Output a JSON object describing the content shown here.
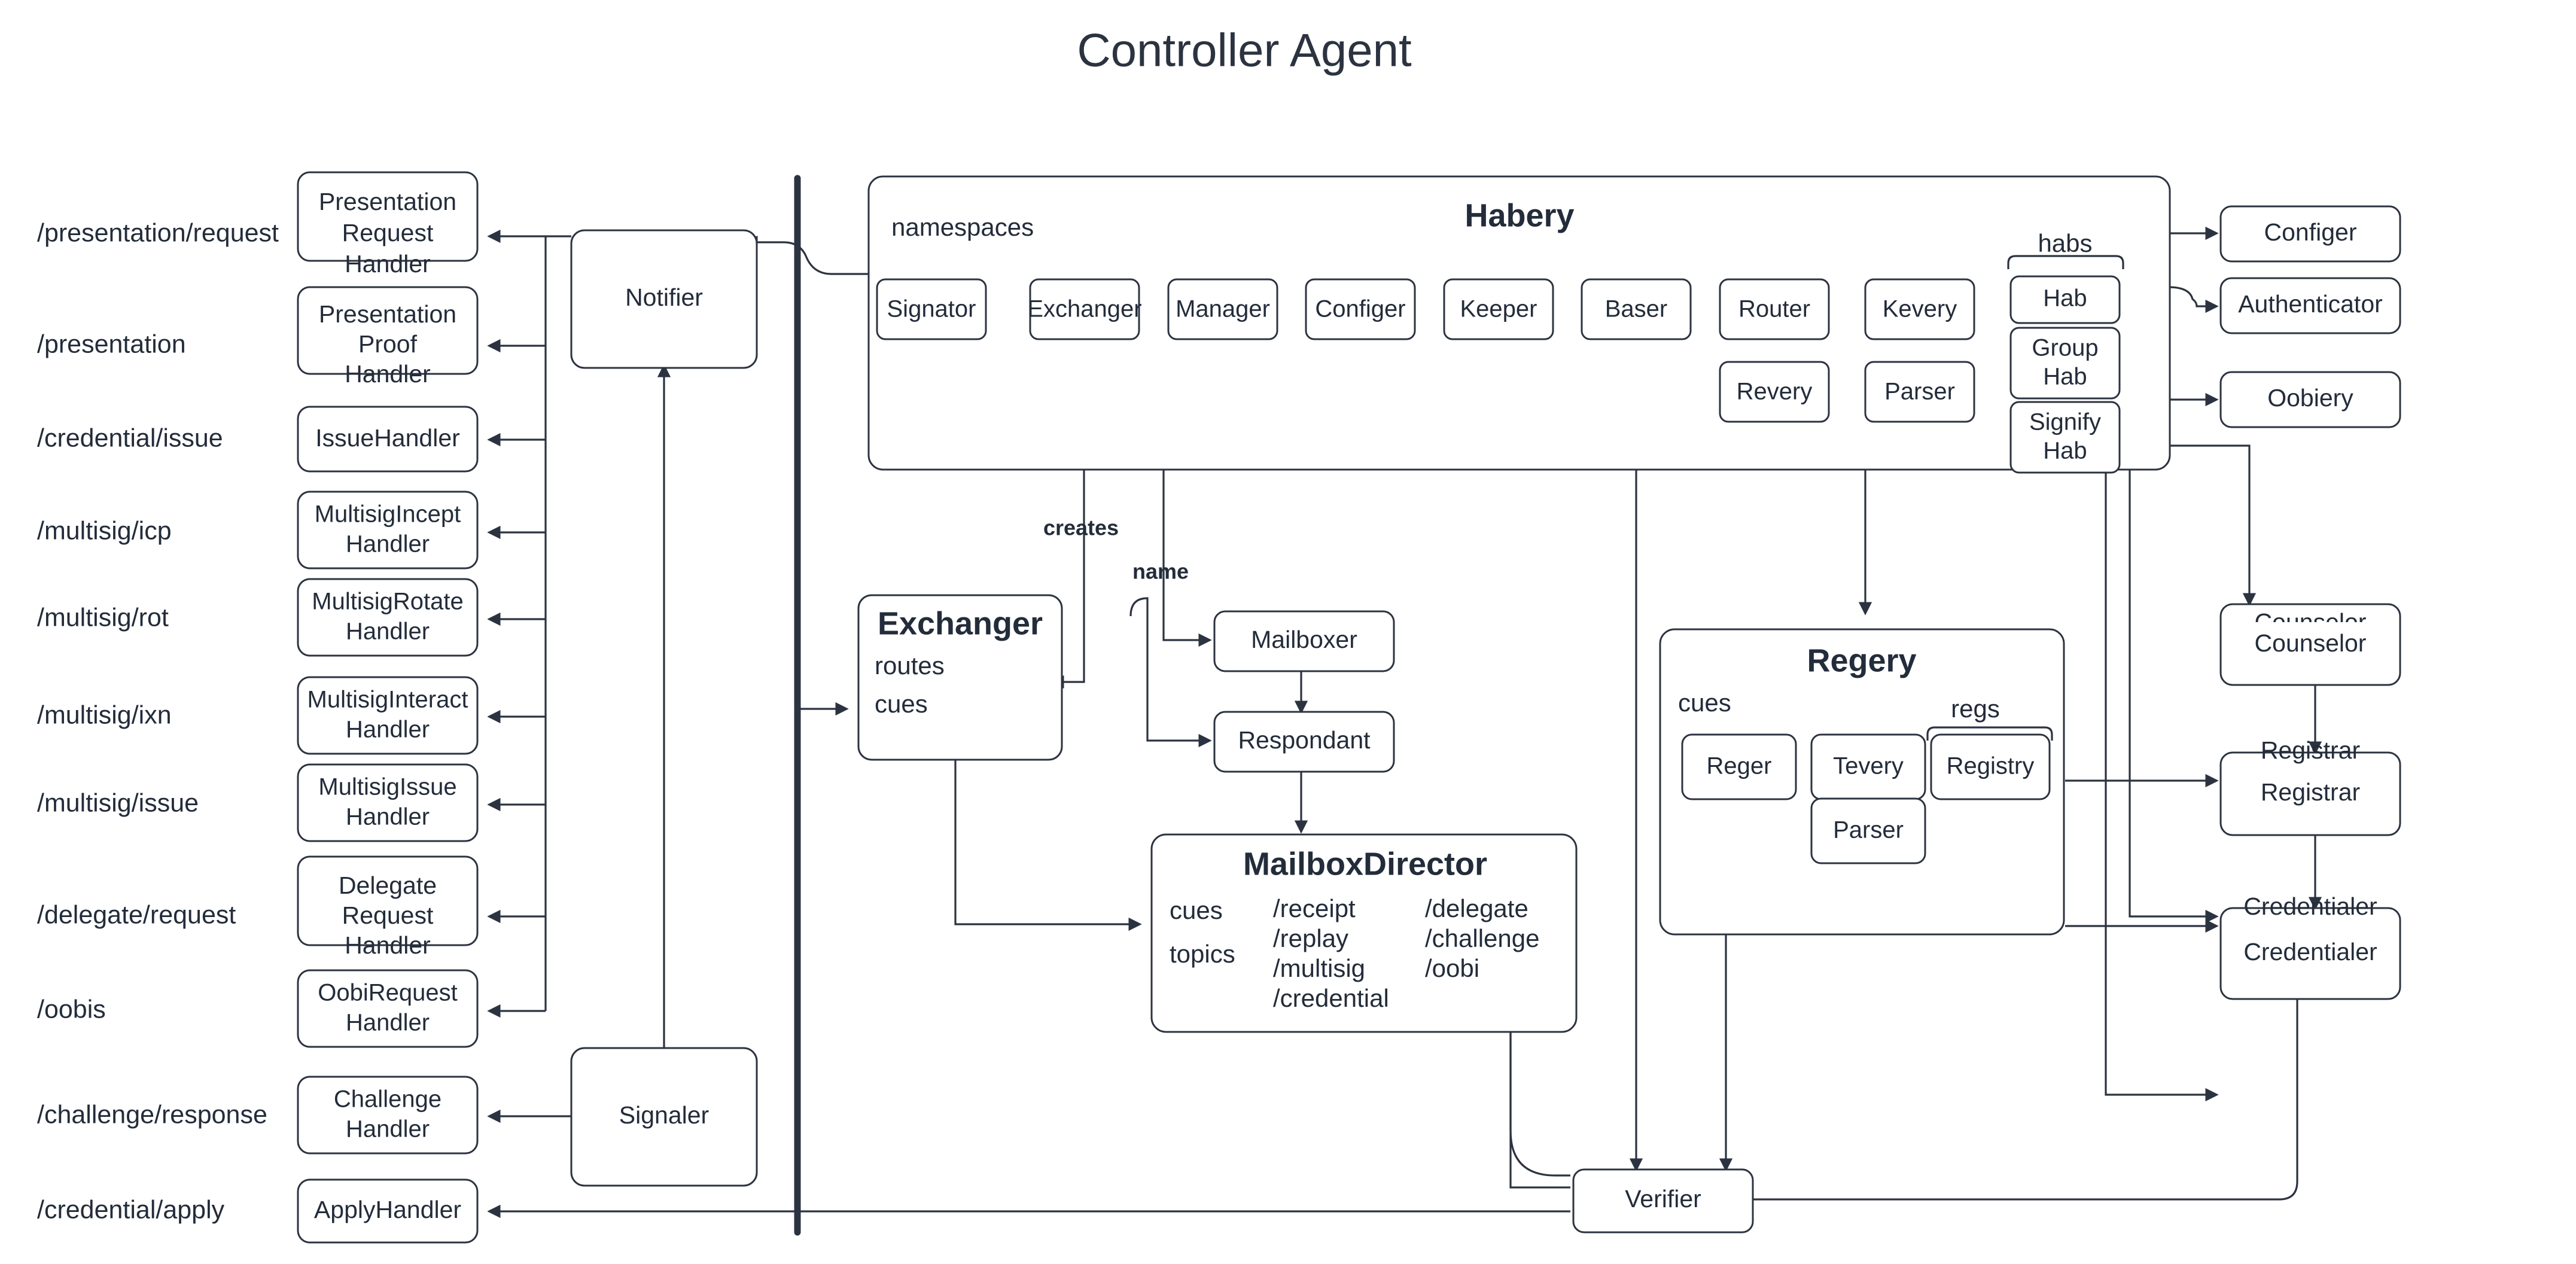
{
  "title": "Controller Agent",
  "routes": [
    {
      "path": "/presentation/request",
      "handler": "Presentation\nRequest\nHandler"
    },
    {
      "path": "/presentation",
      "handler": "Presentation\nProof\nHandler"
    },
    {
      "path": "/credential/issue",
      "handler": "IssueHandler"
    },
    {
      "path": "/multisig/icp",
      "handler": "MultisigIncept\nHandler"
    },
    {
      "path": "/multisig/rot",
      "handler": "MultisigRotate\nHandler"
    },
    {
      "path": "/multisig/ixn",
      "handler": "MultisigInteract\nHandler"
    },
    {
      "path": "/multisig/issue",
      "handler": "MultisigIssue\nHandler"
    },
    {
      "path": "/delegate/request",
      "handler": "Delegate\nRequest\nHandler"
    },
    {
      "path": "/oobis",
      "handler": "OobiRequest\nHandler"
    },
    {
      "path": "/challenge/response",
      "handler": "Challenge\nHandler"
    },
    {
      "path": "/credential/apply",
      "handler": "ApplyHandler"
    }
  ],
  "dispatchers": {
    "notifier": "Notifier",
    "signaler": "Signaler"
  },
  "habery": {
    "title": "Habery",
    "namespaces_label": "namespaces",
    "habs_label": "habs",
    "components_row1": [
      "Signator",
      "Exchanger",
      "Manager",
      "Configer",
      "Keeper",
      "Baser",
      "Router",
      "Kevery"
    ],
    "components_row2": [
      "Revery",
      "Parser"
    ],
    "habs": [
      "Hab",
      "Group\nHab",
      "Signify\nHab"
    ]
  },
  "exchanger": {
    "title": "Exchanger",
    "fields": [
      "routes",
      "cues"
    ]
  },
  "mailboxer": "Mailboxer",
  "respondant": "Respondant",
  "mailbox_director": {
    "title": "MailboxDirector",
    "fields": [
      "cues",
      "topics"
    ],
    "topics_col1": [
      "/receipt",
      "/replay",
      "/multisig",
      "/credential"
    ],
    "topics_col2": [
      "/delegate",
      "/challenge",
      "/oobi"
    ]
  },
  "regery": {
    "title": "Regery",
    "cues_label": "cues",
    "regs_label": "regs",
    "components": [
      "Reger",
      "Tevery",
      "Parser"
    ],
    "regs": [
      "Registry"
    ]
  },
  "right_column": [
    "Configer",
    "Authenticator",
    "Oobiery",
    "Counselor",
    "Registrar",
    "Credentialer"
  ],
  "verifier": "Verifier",
  "edge_labels": {
    "creates": "creates",
    "name": "name"
  },
  "colors": {
    "stroke": "#2c3340",
    "text": "#232c3a",
    "background": "#ffffff"
  }
}
